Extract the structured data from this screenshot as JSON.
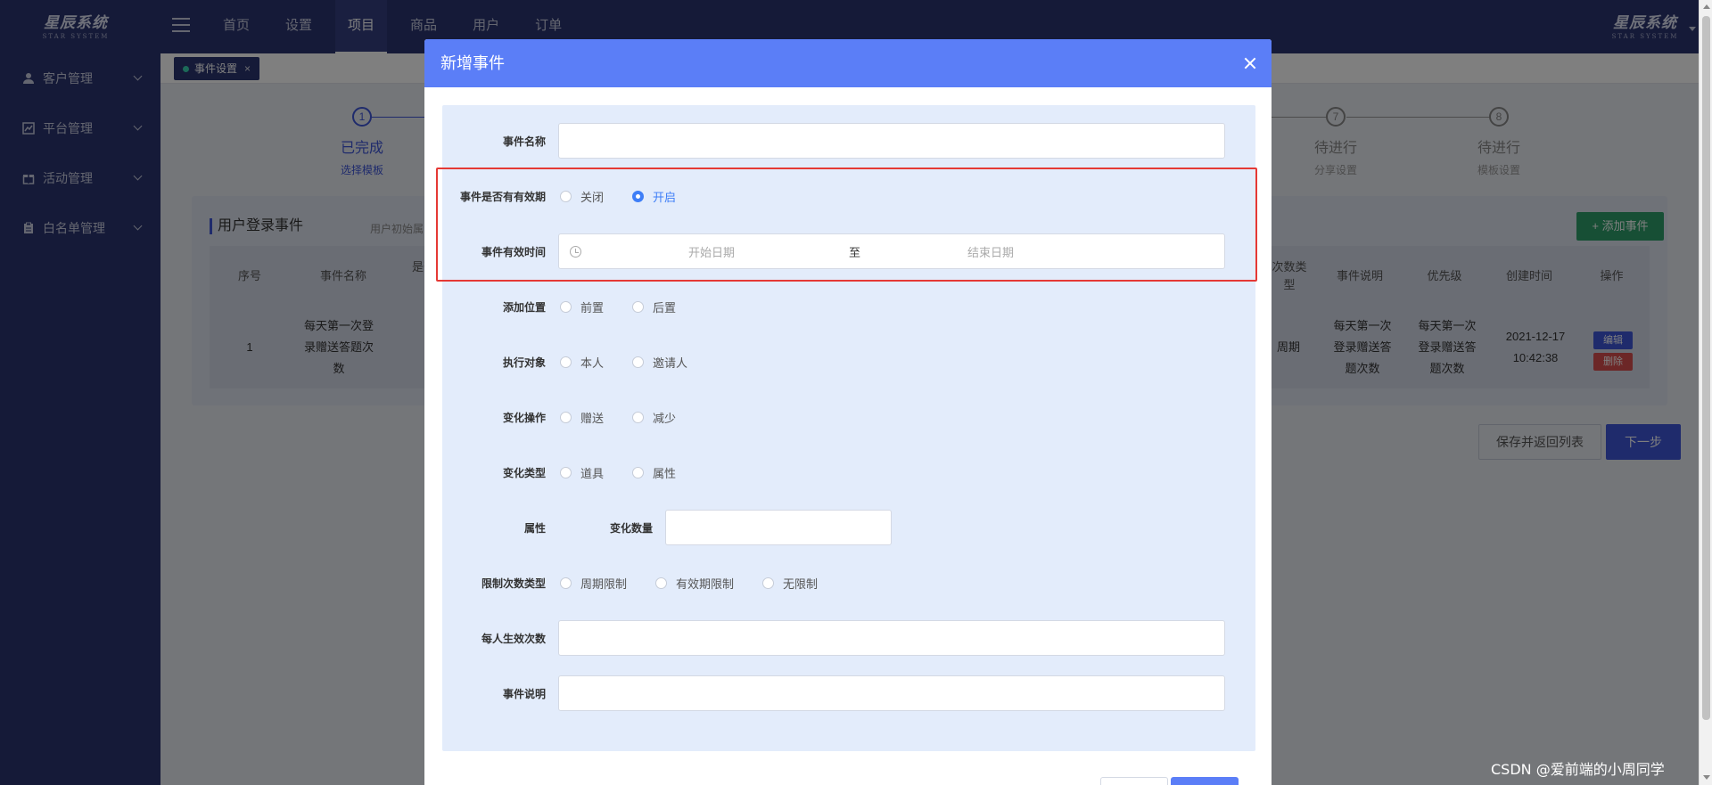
{
  "app": {
    "logo_text": "星辰系统",
    "logo_sub": "STAR SYSTEM"
  },
  "topnav": {
    "items": [
      "首页",
      "设置",
      "项目",
      "商品",
      "用户",
      "订单"
    ],
    "active_index": 2
  },
  "sidebar": {
    "items": [
      {
        "label": "客户管理",
        "icon": "user-icon"
      },
      {
        "label": "平台管理",
        "icon": "chart-icon"
      },
      {
        "label": "活动管理",
        "icon": "gift-icon"
      },
      {
        "label": "白名单管理",
        "icon": "clipboard-icon"
      }
    ]
  },
  "tabs": {
    "active_tab": "事件设置",
    "close": "×"
  },
  "steps": [
    {
      "num": "1",
      "status": "已完成",
      "sub": "选择模板",
      "done": true
    },
    {
      "num": "7",
      "status": "待进行",
      "sub": "分享设置",
      "done": false
    },
    {
      "num": "8",
      "status": "待进行",
      "sub": "模板设置",
      "done": false
    }
  ],
  "card": {
    "title": "用户登录事件",
    "subtitle": "用户初始属",
    "add_button": "+ 添加事件",
    "headers": {
      "index": "序号",
      "name": "事件名称",
      "partial": "是否",
      "limit_type": "次数类型",
      "desc": "事件说明",
      "priority": "优先级",
      "created": "创建时间",
      "ops": "操作"
    },
    "row": {
      "index": "1",
      "name": "每天第一次登录赠送答题次数",
      "limit_type": "周期",
      "desc": "每天第一次登录赠送答题次数",
      "priority": "每天第一次登录赠送答题次数",
      "created": "2021-12-17 10:42:38",
      "edit": "编辑",
      "delete": "删除"
    }
  },
  "buttons": {
    "save_return": "保存并返回列表",
    "next": "下一步"
  },
  "dialog": {
    "title": "新增事件",
    "fields": {
      "event_name": {
        "label": "事件名称",
        "value": ""
      },
      "has_validity": {
        "label": "事件是否有有效期",
        "options": [
          "关闭",
          "开启"
        ],
        "selected": "开启"
      },
      "valid_time": {
        "label": "事件有效时间",
        "start_placeholder": "开始日期",
        "separator": "至",
        "end_placeholder": "结束日期"
      },
      "position": {
        "label": "添加位置",
        "options": [
          "前置",
          "后置"
        ]
      },
      "target": {
        "label": "执行对象",
        "options": [
          "本人",
          "邀请人"
        ]
      },
      "operation": {
        "label": "变化操作",
        "options": [
          "赠送",
          "减少"
        ]
      },
      "change_type": {
        "label": "变化类型",
        "options": [
          "道具",
          "属性"
        ]
      },
      "attribute": {
        "label": "属性",
        "sub_label": "变化数量",
        "value": ""
      },
      "limit_type": {
        "label": "限制次数类型",
        "options": [
          "周期限制",
          "有效期限制",
          "无限制"
        ]
      },
      "per_person": {
        "label": "每人生效次数",
        "value": ""
      },
      "description": {
        "label": "事件说明",
        "value": ""
      }
    }
  },
  "watermark": "CSDN @爱前端的小周同学"
}
